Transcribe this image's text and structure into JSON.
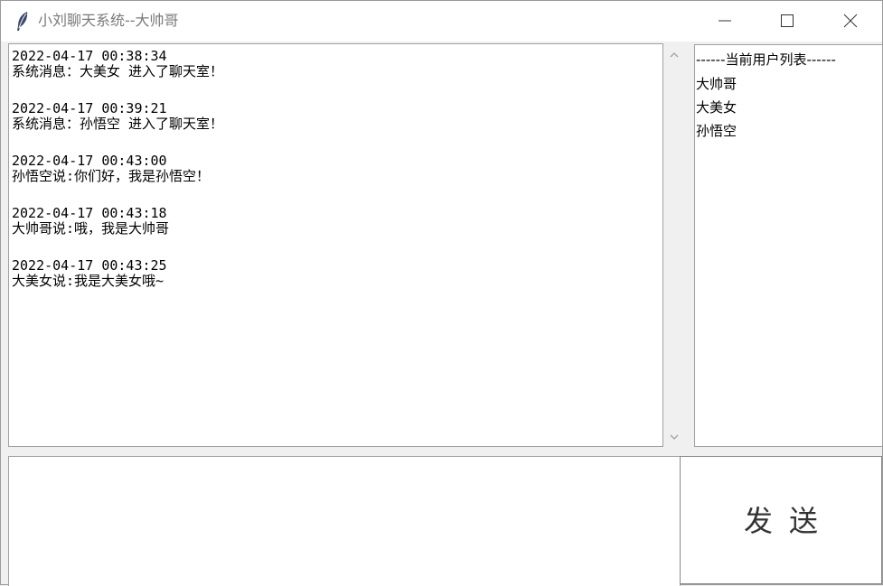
{
  "window": {
    "title": "小刘聊天系统--大帅哥",
    "icon": "feather-icon"
  },
  "chat": {
    "messages": [
      {
        "time": "2022-04-17 00:38:34",
        "text": "系统消息：大美女 进入了聊天室！"
      },
      {
        "time": "2022-04-17 00:39:21",
        "text": "系统消息：孙悟空 进入了聊天室！"
      },
      {
        "time": "2022-04-17 00:43:00",
        "text": "孙悟空说:你们好，我是孙悟空！"
      },
      {
        "time": "2022-04-17 00:43:18",
        "text": "大帅哥说:哦，我是大帅哥"
      },
      {
        "time": "2022-04-17 00:43:25",
        "text": "大美女说:我是大美女哦~"
      }
    ]
  },
  "users": {
    "header": "------当前用户列表------",
    "items": [
      "大帅哥",
      "大美女",
      "孙悟空"
    ]
  },
  "input": {
    "value": ""
  },
  "send": {
    "label": "发送"
  }
}
